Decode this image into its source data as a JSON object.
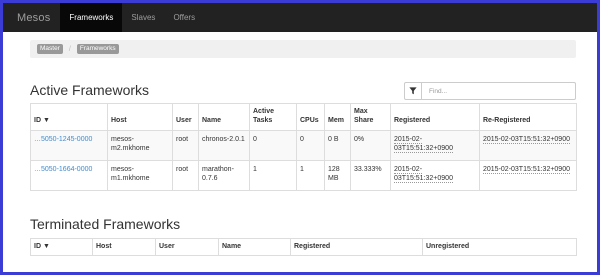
{
  "nav": {
    "brand": "Mesos",
    "items": [
      {
        "label": "Frameworks",
        "active": true
      },
      {
        "label": "Slaves",
        "active": false
      },
      {
        "label": "Offers",
        "active": false
      }
    ]
  },
  "breadcrumb": [
    "Master",
    "Frameworks"
  ],
  "active": {
    "title": "Active Frameworks",
    "filter_placeholder": "Find...",
    "headers": [
      "ID ▼",
      "Host",
      "User",
      "Name",
      "Active Tasks",
      "CPUs",
      "Mem",
      "Max Share",
      "Registered",
      "Re-Registered"
    ],
    "rows": [
      {
        "id": "…5050-1245-0000",
        "host": "mesos-m2.mkhome",
        "user": "root",
        "name": "chronos-2.0.1",
        "tasks": "0",
        "cpus": "0",
        "mem": "0 B",
        "share": "0%",
        "registered": "2015-02-03T15:51:32+0900",
        "reregistered": "2015-02-03T15:51:32+0900"
      },
      {
        "id": "…5050-1664-0000",
        "host": "mesos-m1.mkhome",
        "user": "root",
        "name": "marathon-0.7.6",
        "tasks": "1",
        "cpus": "1",
        "mem": "128 MB",
        "share": "33.333%",
        "registered": "2015-02-03T15:51:32+0900",
        "reregistered": "2015-02-03T15:51:32+0900"
      }
    ]
  },
  "terminated": {
    "title": "Terminated Frameworks",
    "headers": [
      "ID ▼",
      "Host",
      "User",
      "Name",
      "Registered",
      "Unregistered"
    ]
  }
}
